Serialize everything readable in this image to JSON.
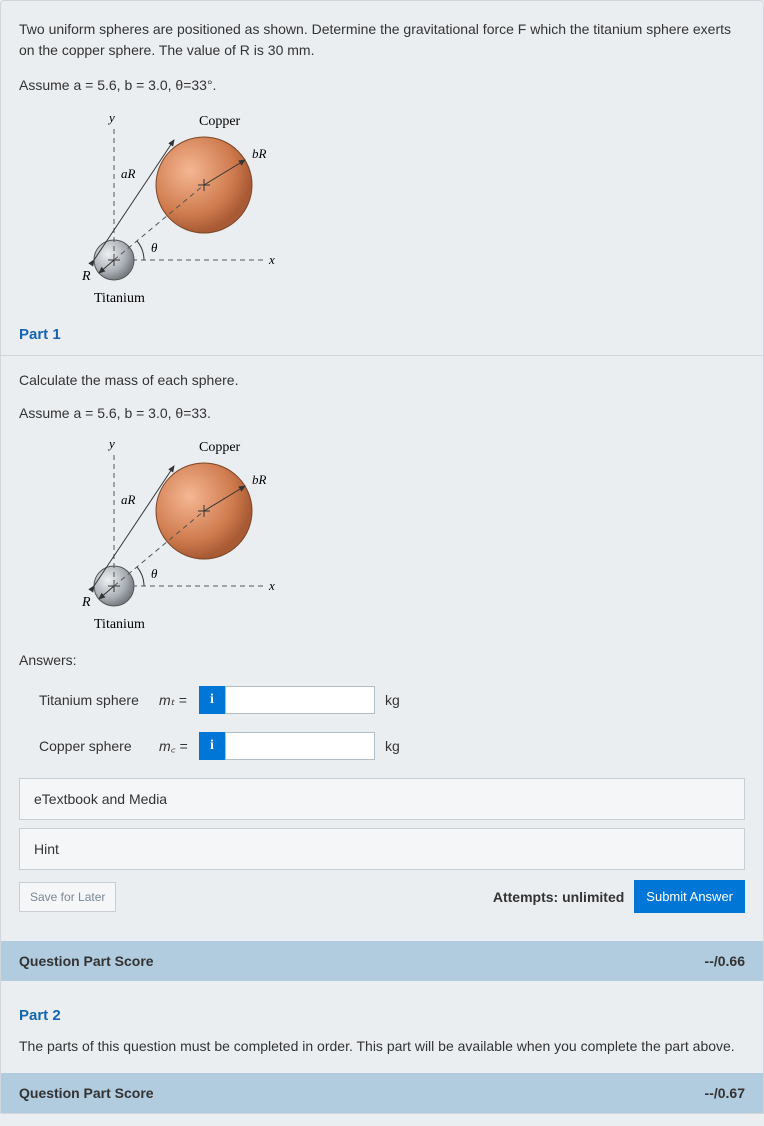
{
  "intro": {
    "line1": "Two uniform spheres are positioned as shown. Determine the gravitational force F which the titanium sphere exerts on the copper sphere. The value of R is 30 mm.",
    "assume": "Assume a = 5.6, b = 3.0, θ=33°."
  },
  "diagram": {
    "copperLabel": "Copper",
    "titaniumLabel": "Titanium",
    "aR": "aR",
    "bR": "bR",
    "R": "R",
    "x": "x",
    "y": "y",
    "theta": "θ"
  },
  "part1": {
    "title": "Part 1",
    "instruction": "Calculate the mass of each sphere.",
    "assume": "Assume a = 5.6, b = 3.0, θ=33.",
    "answersLabel": "Answers:",
    "rows": [
      {
        "label": "Titanium sphere",
        "var": "mₜ =",
        "unit": "kg"
      },
      {
        "label": "Copper sphere",
        "var": "m꜀ =",
        "unit": "kg"
      }
    ],
    "info": "i",
    "etextbook": "eTextbook and Media",
    "hint": "Hint",
    "saveLater": "Save for Later",
    "attempts": "Attempts: unlimited",
    "submit": "Submit Answer",
    "scoreLabel": "Question Part Score",
    "scoreValue": "--/0.66"
  },
  "part2": {
    "title": "Part 2",
    "text": "The parts of this question must be completed in order. This part will be available when you complete the part above.",
    "scoreLabel": "Question Part Score",
    "scoreValue": "--/0.67"
  }
}
